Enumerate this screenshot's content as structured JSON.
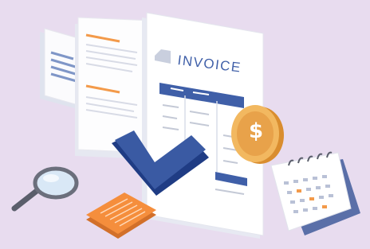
{
  "invoice": {
    "title": "INVOICE"
  },
  "coin": {
    "symbol": "$"
  },
  "colors": {
    "background": "#e8dcef",
    "paper": "#ffffff",
    "accent_blue": "#3f5fa8",
    "accent_orange": "#f39a4a",
    "coin_gold": "#f2b860"
  },
  "icons": [
    "invoice-document-icon",
    "checkmark-icon",
    "dollar-coin-icon",
    "magnifier-icon",
    "calculator-icon",
    "calendar-icon"
  ]
}
